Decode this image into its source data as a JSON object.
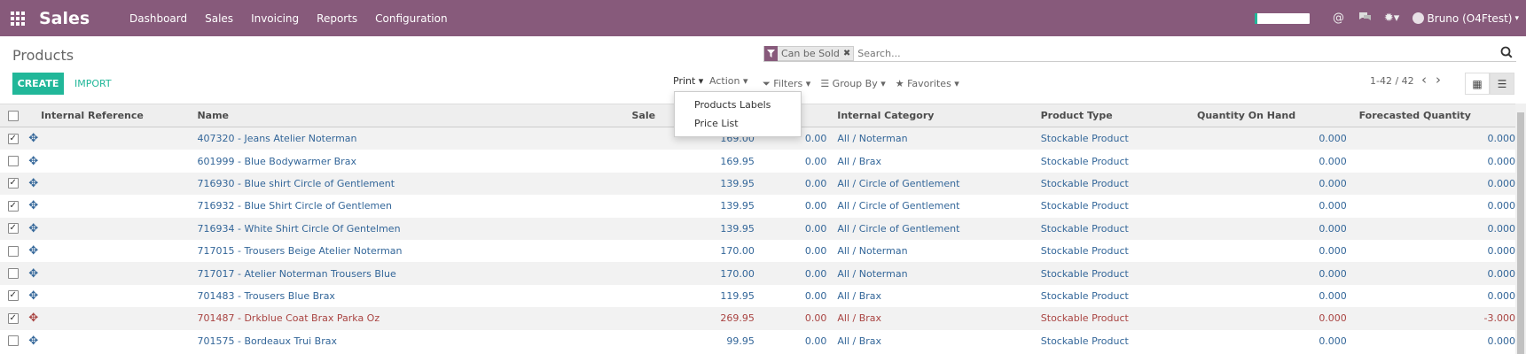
{
  "navbar": {
    "brand": "Sales",
    "menu": [
      "Dashboard",
      "Sales",
      "Invoicing",
      "Reports",
      "Configuration"
    ],
    "user": "Bruno (O4Ftest)",
    "progress": 0.05,
    "accent": "#875a7b"
  },
  "control": {
    "title": "Products",
    "facet": "Can be Sold",
    "search_placeholder": "Search...",
    "create": "CREATE",
    "import": "IMPORT",
    "print": "Print",
    "action": "Action",
    "filters": "Filters",
    "group_by": "Group By",
    "favorites": "Favorites",
    "pager": "1-42 / 42"
  },
  "print_menu": [
    "Products Labels",
    "Price List"
  ],
  "columns": {
    "ref": "Internal Reference",
    "name": "Name",
    "sale": "Sale",
    "category": "Internal Category",
    "type": "Product Type",
    "qoh": "Quantity On Hand",
    "fq": "Forecasted Quantity"
  },
  "rows": [
    {
      "checked": true,
      "name": "407320 - Jeans Atelier Noterman",
      "sale": "169.00",
      "cost": "0.00",
      "category": "All / Noterman",
      "type": "Stockable Product",
      "qoh": "0.000",
      "fq": "0.000",
      "red": false
    },
    {
      "checked": false,
      "name": "601999 - Blue Bodywarmer Brax",
      "sale": "169.95",
      "cost": "0.00",
      "category": "All / Brax",
      "type": "Stockable Product",
      "qoh": "0.000",
      "fq": "0.000",
      "red": false
    },
    {
      "checked": true,
      "name": "716930 - Blue shirt Circle of Gentlement",
      "sale": "139.95",
      "cost": "0.00",
      "category": "All / Circle of Gentlement",
      "type": "Stockable Product",
      "qoh": "0.000",
      "fq": "0.000",
      "red": false
    },
    {
      "checked": true,
      "name": "716932 - Blue Shirt Circle of Gentlemen",
      "sale": "139.95",
      "cost": "0.00",
      "category": "All / Circle of Gentlement",
      "type": "Stockable Product",
      "qoh": "0.000",
      "fq": "0.000",
      "red": false
    },
    {
      "checked": true,
      "name": "716934 - White Shirt Circle Of Gentelmen",
      "sale": "139.95",
      "cost": "0.00",
      "category": "All / Circle of Gentlement",
      "type": "Stockable Product",
      "qoh": "0.000",
      "fq": "0.000",
      "red": false
    },
    {
      "checked": false,
      "name": "717015 - Trousers Beige Atelier Noterman",
      "sale": "170.00",
      "cost": "0.00",
      "category": "All / Noterman",
      "type": "Stockable Product",
      "qoh": "0.000",
      "fq": "0.000",
      "red": false
    },
    {
      "checked": false,
      "name": "717017 - Atelier Noterman Trousers Blue",
      "sale": "170.00",
      "cost": "0.00",
      "category": "All / Noterman",
      "type": "Stockable Product",
      "qoh": "0.000",
      "fq": "0.000",
      "red": false
    },
    {
      "checked": true,
      "name": "701483 - Trousers Blue Brax",
      "sale": "119.95",
      "cost": "0.00",
      "category": "All / Brax",
      "type": "Stockable Product",
      "qoh": "0.000",
      "fq": "0.000",
      "red": false
    },
    {
      "checked": true,
      "name": "701487 - Drkblue Coat Brax Parka Oz",
      "sale": "269.95",
      "cost": "0.00",
      "category": "All / Brax",
      "type": "Stockable Product",
      "qoh": "0.000",
      "fq": "-3.000",
      "red": true
    },
    {
      "checked": false,
      "name": "701575 - Bordeaux Trui Brax",
      "sale": "99.95",
      "cost": "0.00",
      "category": "All / Brax",
      "type": "Stockable Product",
      "qoh": "0.000",
      "fq": "0.000",
      "red": false
    }
  ]
}
